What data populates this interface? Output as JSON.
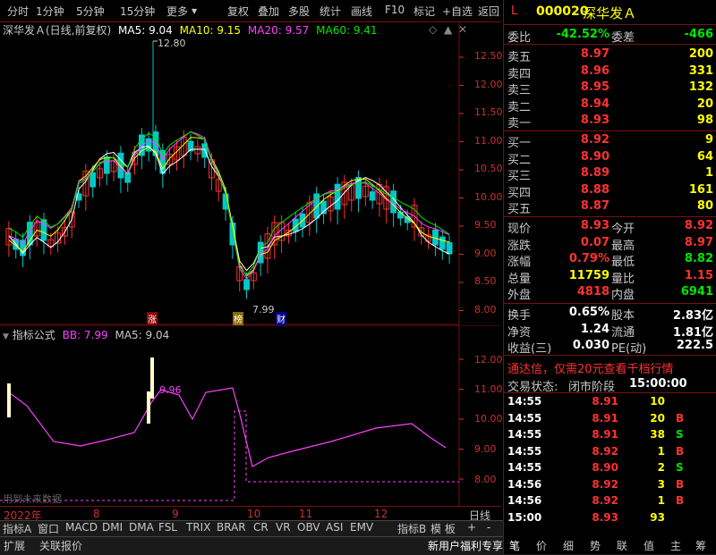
{
  "toolbar": {
    "left": [
      "分时",
      "1分钟",
      "5分钟",
      "15分钟",
      "更多"
    ],
    "right": [
      "复权",
      "叠加",
      "多股",
      "统计",
      "画线",
      "F10",
      "标记",
      "+自选",
      "返回"
    ]
  },
  "chart": {
    "title": "深华发Ａ(日线,前复权)",
    "ma": [
      {
        "label": "MA5: 9.04",
        "color": "#ffffff"
      },
      {
        "label": "MA10: 9.15",
        "color": "#ffff00"
      },
      {
        "label": "MA20: 9.57",
        "color": "#ff40ff"
      },
      {
        "label": "MA60: 9.41",
        "color": "#00e600"
      }
    ],
    "high_label": "12.80",
    "low_label": "7.99",
    "badges": [
      "涨",
      "榜",
      "财"
    ],
    "price_axis": [
      "12.50",
      "12.00",
      "11.50",
      "11.00",
      "10.50",
      "10.00",
      "9.50",
      "9.00",
      "8.50",
      "8.00"
    ]
  },
  "indicator": {
    "title": "指标公式",
    "bb": "BB: 7.99",
    "ma5": "MA5: 9.04",
    "peak_label": "9.96",
    "note": "用到未来数据",
    "axis": [
      "12.00",
      "11.00",
      "10.00",
      "9.00",
      "8.00"
    ]
  },
  "time_axis": {
    "labels": [
      "2022年",
      "8",
      "9",
      "10",
      "11",
      "12"
    ],
    "period": "日线"
  },
  "bottom_tabs": [
    "指标A",
    "窗口",
    "MACD",
    "DMI",
    "DMA",
    "FSL",
    "TRIX",
    "BRAR",
    "CR",
    "VR",
    "OBV",
    "ASI",
    "EMV",
    "指标B",
    "模 板",
    "+",
    "-"
  ],
  "bottom_tabs2": [
    "扩展",
    "关联报价"
  ],
  "bottom_right_label": "新用户福利专享",
  "quote": {
    "code_prefix": "L",
    "code": "000020",
    "name": "深华发Ａ",
    "weibi_label": "委比",
    "weibi": "-42.52%",
    "weicha_label": "委差",
    "weicha": "-466",
    "asks": [
      {
        "label": "卖五",
        "price": "8.97",
        "vol": "200"
      },
      {
        "label": "卖四",
        "price": "8.96",
        "vol": "331"
      },
      {
        "label": "卖三",
        "price": "8.95",
        "vol": "132"
      },
      {
        "label": "卖二",
        "price": "8.94",
        "vol": "20"
      },
      {
        "label": "卖一",
        "price": "8.93",
        "vol": "98"
      }
    ],
    "bids": [
      {
        "label": "买一",
        "price": "8.92",
        "vol": "9"
      },
      {
        "label": "买二",
        "price": "8.90",
        "vol": "64"
      },
      {
        "label": "买三",
        "price": "8.89",
        "vol": "1"
      },
      {
        "label": "买四",
        "price": "8.88",
        "vol": "161"
      },
      {
        "label": "买五",
        "price": "8.87",
        "vol": "80"
      }
    ],
    "stats": [
      {
        "l1": "现价",
        "v1": "8.93",
        "c1": "red",
        "l2": "今开",
        "v2": "8.92",
        "c2": "red"
      },
      {
        "l1": "涨跌",
        "v1": "0.07",
        "c1": "red",
        "l2": "最高",
        "v2": "8.97",
        "c2": "red"
      },
      {
        "l1": "涨幅",
        "v1": "0.79%",
        "c1": "red",
        "l2": "最低",
        "v2": "8.82",
        "c2": "green"
      },
      {
        "l1": "总量",
        "v1": "11759",
        "c1": "yellow",
        "l2": "量比",
        "v2": "1.15",
        "c2": "red"
      },
      {
        "l1": "外盘",
        "v1": "4818",
        "c1": "red",
        "l2": "内盘",
        "v2": "6941",
        "c2": "green"
      }
    ],
    "stats2": [
      {
        "l1": "换手",
        "v1": "0.65%",
        "l2": "股本",
        "v2": "2.83亿"
      },
      {
        "l1": "净资",
        "v1": "1.24",
        "l2": "流通",
        "v2": "1.81亿"
      },
      {
        "l1": "收益(三)",
        "v1": "0.030",
        "l2": "PE(动)",
        "v2": "222.5"
      }
    ],
    "promo": "通达信，仅需20元查看千档行情",
    "trade_status_label": "交易状态:",
    "trade_status": "闭市阶段",
    "trade_time": "15:00:00",
    "ticks": [
      {
        "time": "14:55",
        "price": "8.91",
        "vol": "10",
        "side": ""
      },
      {
        "time": "14:55",
        "price": "8.91",
        "vol": "20",
        "side": "B"
      },
      {
        "time": "14:55",
        "price": "8.91",
        "vol": "38",
        "side": "S"
      },
      {
        "time": "14:55",
        "price": "8.92",
        "vol": "1",
        "side": "B"
      },
      {
        "time": "14:55",
        "price": "8.90",
        "vol": "2",
        "side": "S"
      },
      {
        "time": "14:56",
        "price": "8.92",
        "vol": "3",
        "side": "B"
      },
      {
        "time": "14:56",
        "price": "8.92",
        "vol": "1",
        "side": "B"
      },
      {
        "time": "15:00",
        "price": "8.93",
        "vol": "93",
        "side": ""
      }
    ],
    "tabs": [
      "笔",
      "价",
      "细",
      "势",
      "联",
      "值",
      "主",
      "筹"
    ]
  }
}
